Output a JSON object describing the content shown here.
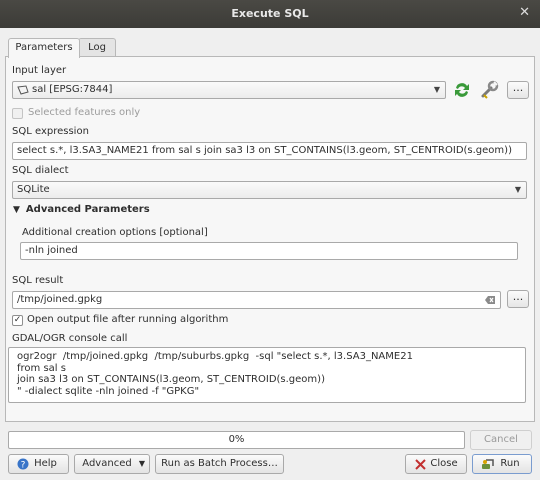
{
  "window": {
    "title": "Execute SQL"
  },
  "tabs": [
    {
      "label": "Parameters"
    },
    {
      "label": "Log"
    }
  ],
  "input_layer": {
    "label": "Input layer",
    "value": "sal [EPSG:7844]"
  },
  "selected_only": {
    "label": "Selected features only",
    "checked": false
  },
  "sql_expression": {
    "label": "SQL expression",
    "value": "select s.*, l3.SA3_NAME21 from sal s  join sa3 l3 on ST_CONTAINS(l3.geom, ST_CENTROID(s.geom))"
  },
  "sql_dialect": {
    "label": "SQL dialect",
    "value": "SQLite"
  },
  "advanced": {
    "header": "Advanced Parameters",
    "creation_label": "Additional creation options [optional]",
    "creation_value": "-nln joined"
  },
  "sql_result": {
    "label": "SQL result",
    "value": "/tmp/joined.gpkg",
    "browse": "..."
  },
  "open_output": {
    "label": "Open output file after running algorithm",
    "checked": true
  },
  "console": {
    "label": "GDAL/OGR console call",
    "lines": [
      "ogr2ogr  /tmp/joined.gpkg  /tmp/suburbs.gpkg  -sql \"select s.*, l3.SA3_NAME21",
      "from sal s",
      "join sa3 l3 on ST_CONTAINS(l3.geom, ST_CENTROID(s.geom))",
      "\" -dialect sqlite -nln joined -f \"GPKG\""
    ]
  },
  "progress": {
    "text": "0%",
    "value": 0
  },
  "buttons": {
    "cancel": "Cancel",
    "help": "Help",
    "advanced": "Advanced",
    "batch": "Run as Batch Process…",
    "close": "Close",
    "run": "Run",
    "more": "..."
  },
  "icons": {
    "layer": "polygon-layer-icon",
    "iterate": "iterate-icon",
    "settings": "wrench-icon",
    "help": "help-icon",
    "close": "close-icon",
    "run": "run-icon"
  },
  "colors": {
    "titlebar": "#3c3b37",
    "iterate": "#3a9a3a",
    "help": "#3874c8",
    "close_x": "#c23030"
  }
}
